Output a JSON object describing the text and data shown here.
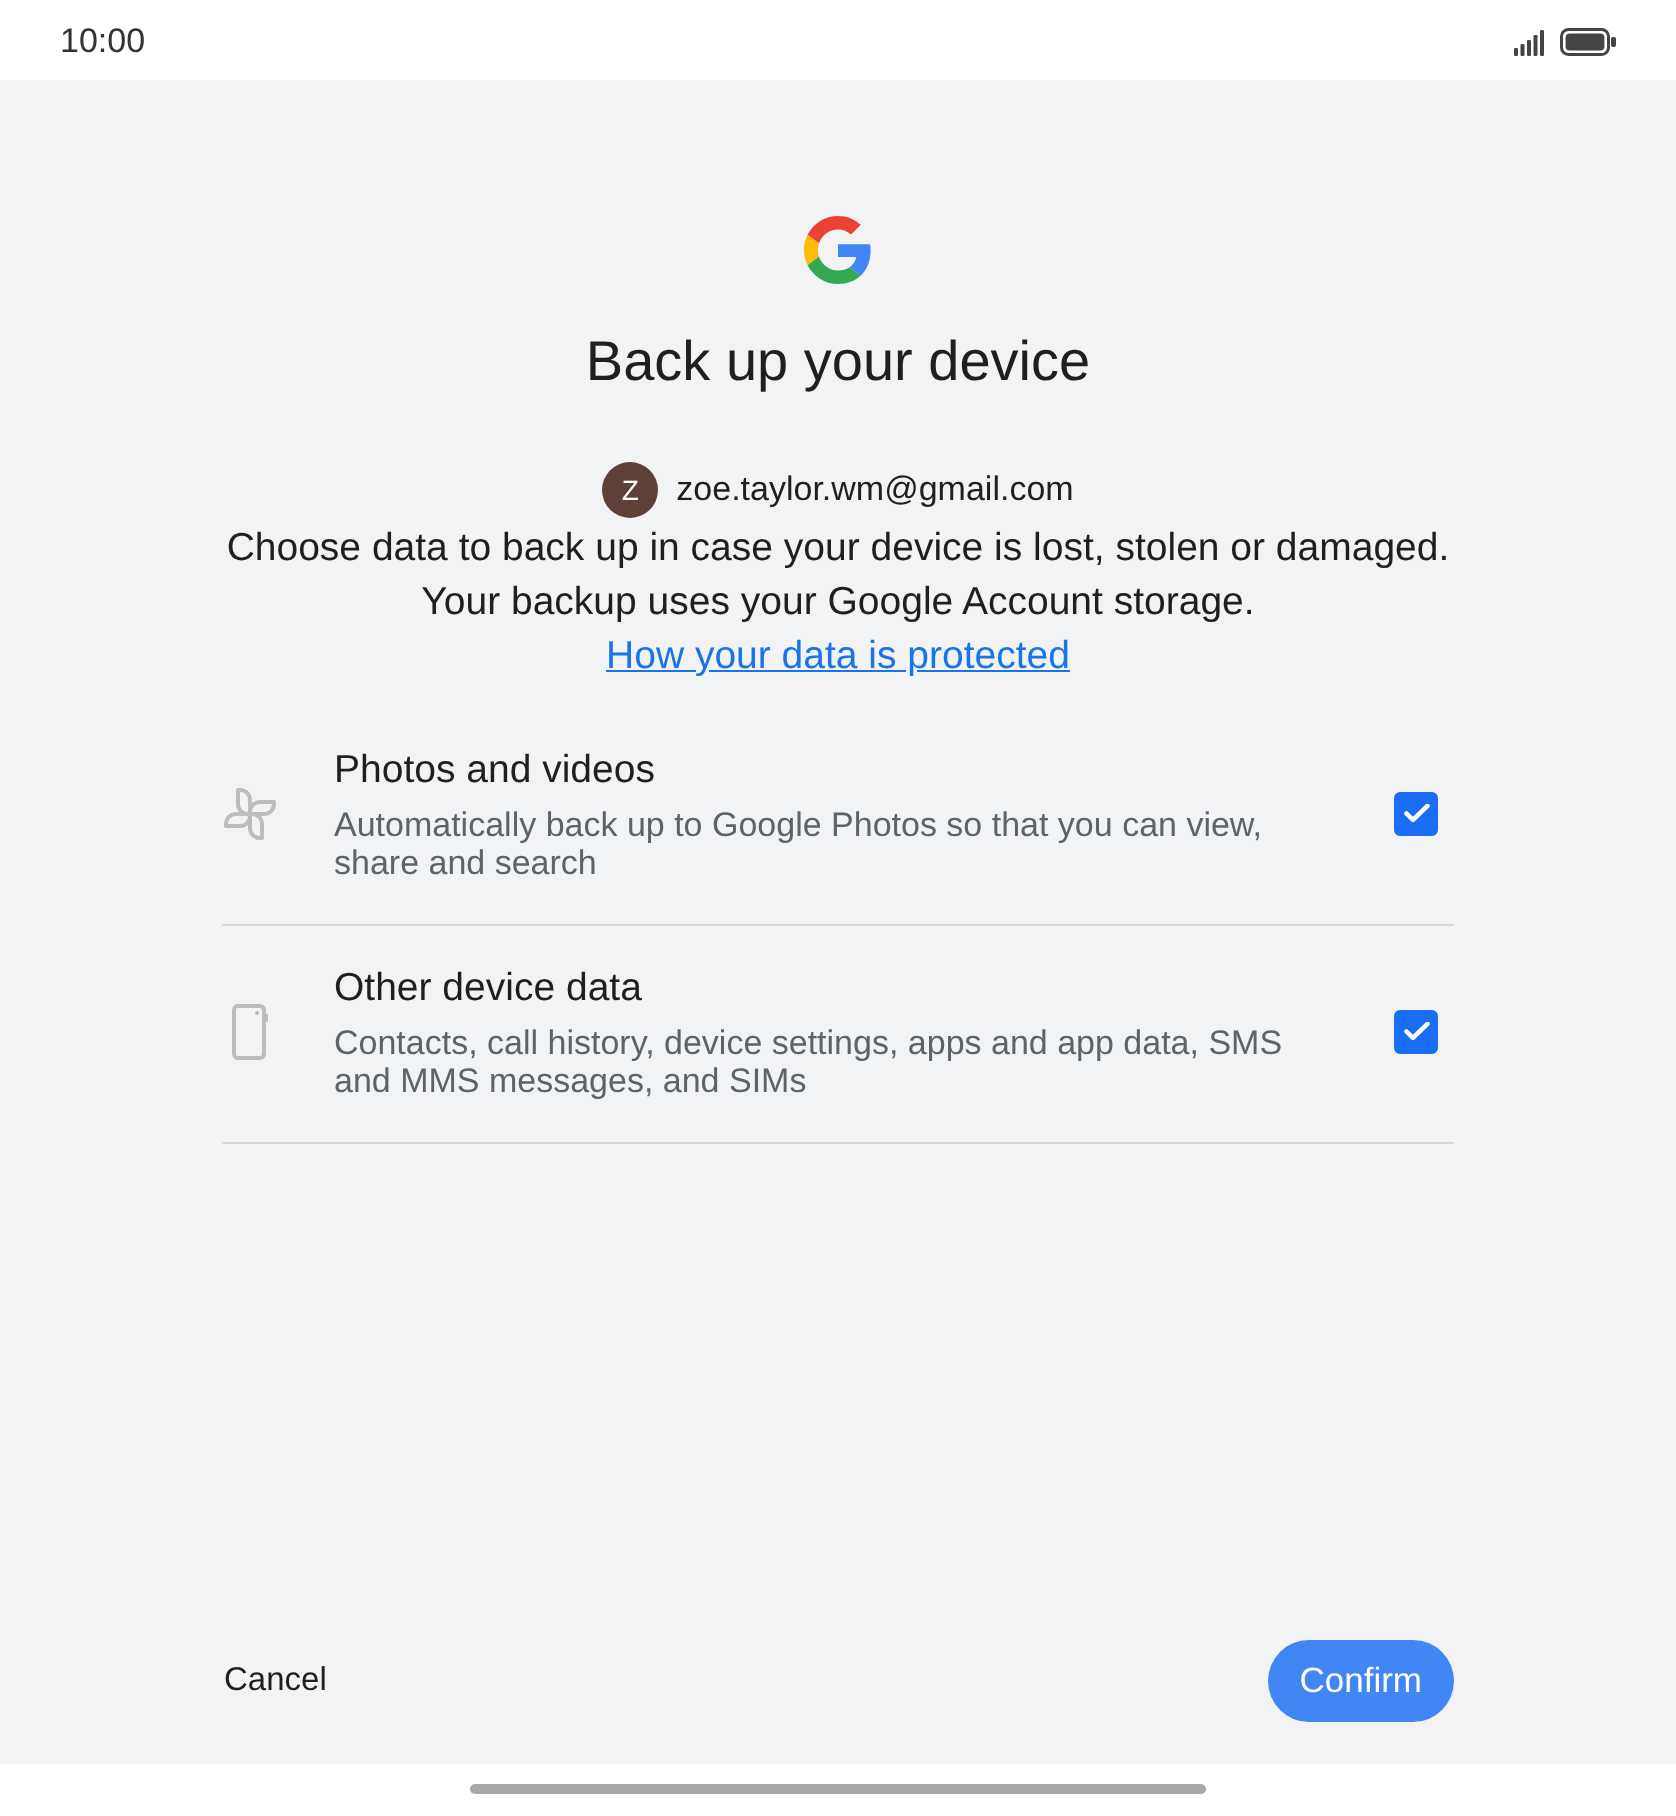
{
  "status_bar": {
    "time": "10:00"
  },
  "header": {
    "title": "Back up your device"
  },
  "account": {
    "avatar_letter": "Z",
    "email": "zoe.taylor.wm@gmail.com"
  },
  "description": {
    "lines": [
      "Choose data to back up in case your device is lost, stolen or damaged.",
      "Your backup uses your Google Account storage."
    ],
    "link": "How your data is protected"
  },
  "options": [
    {
      "kind": "photos",
      "title": "Photos and videos",
      "subtitle": "Automatically back up to Google Photos so that you can view, share and search",
      "checked": true
    },
    {
      "kind": "device",
      "title": "Other device data",
      "subtitle": "Contacts, call history, device settings, apps and app data, SMS and MMS messages, and SIMs",
      "checked": true
    }
  ],
  "buttons": {
    "cancel": "Cancel",
    "confirm": "Confirm"
  }
}
